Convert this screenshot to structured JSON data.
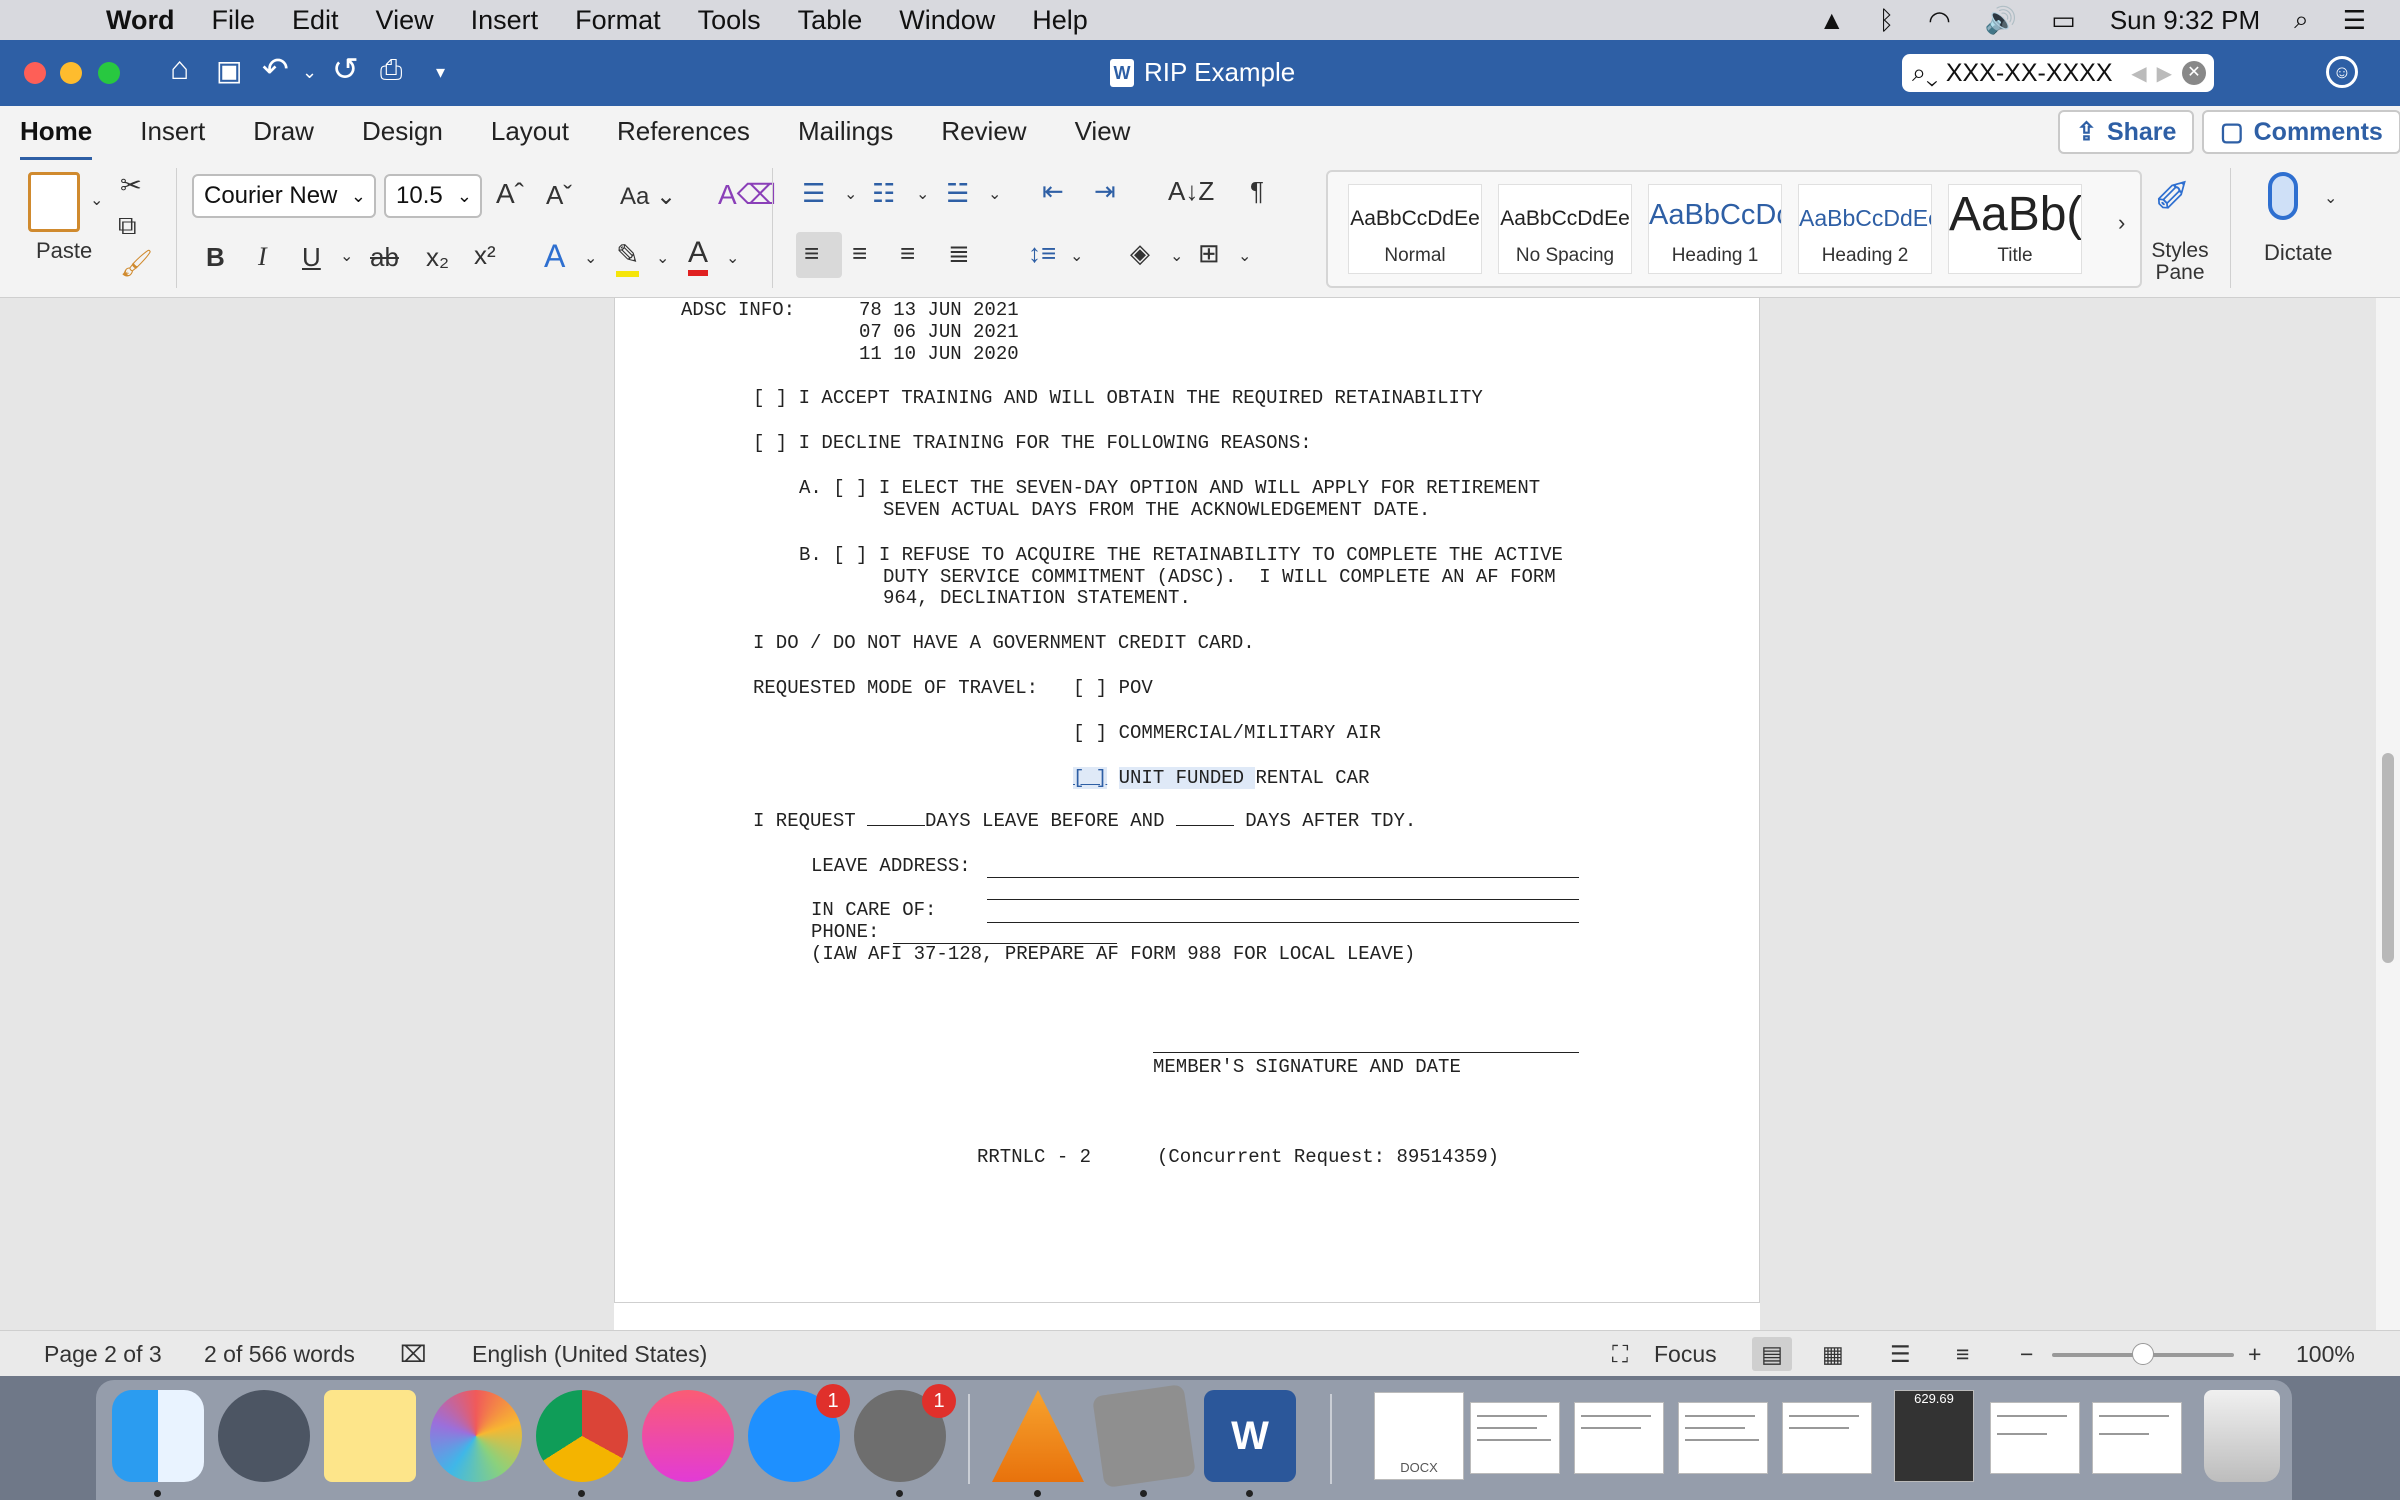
{
  "menubar": {
    "app": "Word",
    "items": [
      "File",
      "Edit",
      "View",
      "Insert",
      "Format",
      "Tools",
      "Table",
      "Window",
      "Help"
    ],
    "clock": "Sun 9:32 PM"
  },
  "titlebar": {
    "title": "RIP Example",
    "search_value": "XXX-XX-XXXX"
  },
  "tabs": [
    "Home",
    "Insert",
    "Draw",
    "Design",
    "Layout",
    "References",
    "Mailings",
    "Review",
    "View"
  ],
  "actions": {
    "share": "Share",
    "comments": "Comments"
  },
  "ribbon": {
    "paste": "Paste",
    "font_name": "Courier New",
    "font_size": "10.5",
    "styles": [
      {
        "preview": "AaBbCcDdEe",
        "name": "Normal"
      },
      {
        "preview": "AaBbCcDdEe",
        "name": "No Spacing"
      },
      {
        "preview": "AaBbCcDc",
        "name": "Heading 1"
      },
      {
        "preview": "AaBbCcDdEe",
        "name": "Heading 2"
      },
      {
        "preview": "AaBb(",
        "name": "Title"
      }
    ],
    "styles_pane": "Styles Pane",
    "dictate": "Dictate"
  },
  "document": {
    "adsc_label": "ADSC INFO:",
    "adsc_values": [
      "78 13 JUN 2021",
      "07 06 JUN 2021",
      "11 10 JUN 2020"
    ],
    "accept": "[ ] I ACCEPT TRAINING AND WILL OBTAIN THE REQUIRED RETAINABILITY",
    "decline": "[ ] I DECLINE TRAINING FOR THE FOLLOWING REASONS:",
    "option_a_1": "A. [ ] I ELECT THE SEVEN-DAY OPTION AND WILL APPLY FOR RETIREMENT",
    "option_a_2": "SEVEN ACTUAL DAYS FROM THE ACKNOWLEDGEMENT DATE.",
    "option_b_1": "B. [ ] I REFUSE TO ACQUIRE THE RETAINABILITY TO COMPLETE THE ACTIVE",
    "option_b_2": "DUTY SERVICE COMMITMENT (ADSC).  I WILL COMPLETE AN AF FORM",
    "option_b_3": "964, DECLINATION STATEMENT.",
    "credit_card": "I DO / DO NOT HAVE A GOVERNMENT CREDIT CARD.",
    "travel_label": "REQUESTED MODE OF TRAVEL:",
    "travel_options": [
      "[ ] POV",
      "[ ] COMMERCIAL/MILITARY AIR"
    ],
    "travel_rental_box": "[ ]",
    "travel_rental_selected": "UNIT FUNDED ",
    "travel_rental_rest": "RENTAL CAR",
    "leave_a": "I REQUEST ",
    "leave_b": "DAYS LEAVE BEFORE AND ",
    "leave_c": " DAYS AFTER TDY.",
    "leave_address": "LEAVE ADDRESS:",
    "in_care_of": "IN CARE OF:",
    "phone": "PHONE:",
    "iaw_note": "(IAW AFI 37-128, PREPARE AF FORM 988 FOR LOCAL LEAVE)",
    "signature": "MEMBER'S SIGNATURE AND DATE",
    "footer_code": "RRTNLC - 2",
    "footer_request": "(Concurrent Request: 89514359)"
  },
  "status": {
    "page": "Page 2 of 3",
    "words": "2 of 566 words",
    "language": "English (United States)",
    "focus": "Focus",
    "zoom": "100%",
    "zoom_level": 0.5
  },
  "dock": {
    "appstore_badge": "1",
    "prefs_badge": "1",
    "calc_display": "629.69",
    "docx_label": "DOCX"
  }
}
